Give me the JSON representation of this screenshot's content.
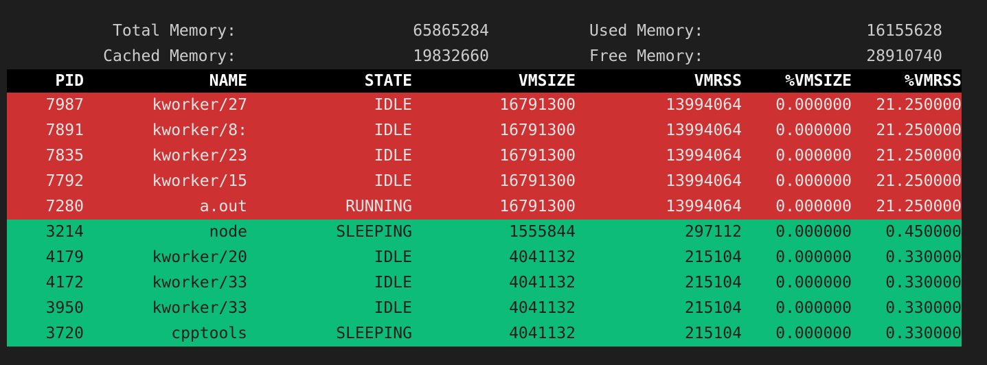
{
  "summary": {
    "total_label": "Total Memory:",
    "total_value": "65865284",
    "used_label": "Used Memory:",
    "used_value": "16155628",
    "cached_label": "Cached Memory:",
    "cached_value": "19832660",
    "free_label": "Free Memory:",
    "free_value": "28910740"
  },
  "columns": [
    "PID",
    "NAME",
    "STATE",
    "VMSIZE",
    "VMRSS",
    "%VMSIZE",
    "%VMRSS"
  ],
  "colors": {
    "background": "#1e1e1e",
    "header_bg": "#000000",
    "high_usage_row": "#cd3131",
    "low_usage_row": "#0dbc79"
  },
  "rows": [
    {
      "group": "hot",
      "cells": [
        "7987",
        "kworker/27",
        "IDLE",
        "16791300",
        "13994064",
        "0.000000",
        "21.250000"
      ]
    },
    {
      "group": "hot",
      "cells": [
        "7891",
        "kworker/8:",
        "IDLE",
        "16791300",
        "13994064",
        "0.000000",
        "21.250000"
      ]
    },
    {
      "group": "hot",
      "cells": [
        "7835",
        "kworker/23",
        "IDLE",
        "16791300",
        "13994064",
        "0.000000",
        "21.250000"
      ]
    },
    {
      "group": "hot",
      "cells": [
        "7792",
        "kworker/15",
        "IDLE",
        "16791300",
        "13994064",
        "0.000000",
        "21.250000"
      ]
    },
    {
      "group": "hot",
      "cells": [
        "7280",
        "a.out",
        "RUNNING",
        "16791300",
        "13994064",
        "0.000000",
        "21.250000"
      ]
    },
    {
      "group": "cool",
      "cells": [
        "3214",
        "node",
        "SLEEPING",
        "1555844",
        "297112",
        "0.000000",
        "0.450000"
      ]
    },
    {
      "group": "cool",
      "cells": [
        "4179",
        "kworker/20",
        "IDLE",
        "4041132",
        "215104",
        "0.000000",
        "0.330000"
      ]
    },
    {
      "group": "cool",
      "cells": [
        "4172",
        "kworker/33",
        "IDLE",
        "4041132",
        "215104",
        "0.000000",
        "0.330000"
      ]
    },
    {
      "group": "cool",
      "cells": [
        "3950",
        "kworker/33",
        "IDLE",
        "4041132",
        "215104",
        "0.000000",
        "0.330000"
      ]
    },
    {
      "group": "cool",
      "cells": [
        "3720",
        "cpptools",
        "SLEEPING",
        "4041132",
        "215104",
        "0.000000",
        "0.330000"
      ]
    }
  ]
}
